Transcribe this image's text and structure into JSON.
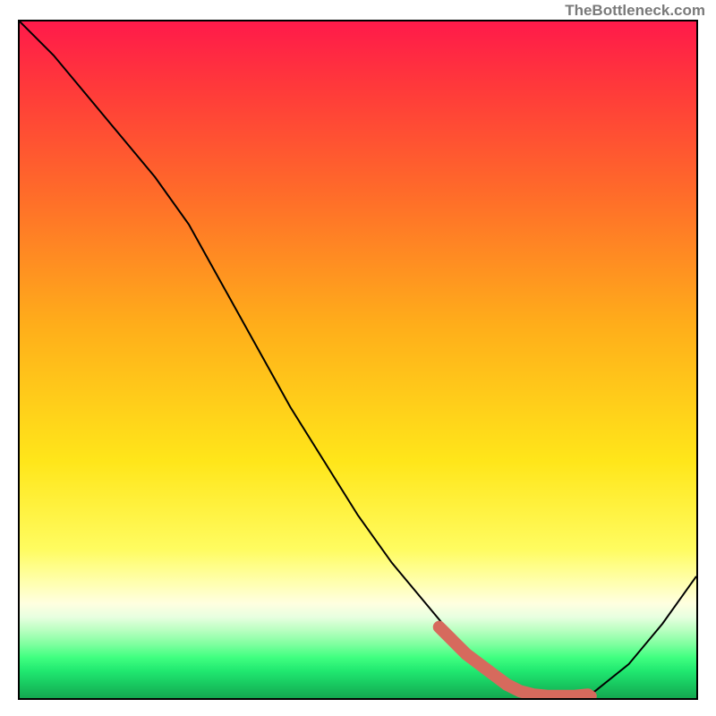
{
  "watermark": "TheBottleneck.com",
  "chart_data": {
    "type": "line",
    "title": "",
    "xlabel": "",
    "ylabel": "",
    "xlim": [
      0,
      100
    ],
    "ylim": [
      0,
      100
    ],
    "grid": false,
    "legend": false,
    "series": [
      {
        "name": "curve",
        "x": [
          0,
          5,
          10,
          15,
          20,
          25,
          30,
          35,
          40,
          45,
          50,
          55,
          60,
          65,
          70,
          75,
          80,
          82,
          85,
          90,
          95,
          100
        ],
        "y": [
          100,
          95,
          89,
          83,
          77,
          70,
          61,
          52,
          43,
          35,
          27,
          20,
          14,
          8,
          4,
          1,
          0,
          0,
          1,
          5,
          11,
          18
        ],
        "color": "#000000"
      },
      {
        "name": "highlight",
        "x": [
          62,
          64,
          66,
          68,
          70,
          72,
          74,
          76,
          78,
          80,
          82,
          84
        ],
        "y": [
          10.5,
          8.5,
          6.5,
          5,
          3.5,
          2,
          1,
          0.5,
          0.3,
          0.3,
          0.3,
          0.5
        ],
        "color": "#d66a5d"
      }
    ],
    "gradient": {
      "top_color": "#ff1a4a",
      "mid_color": "#ffe61a",
      "bottom_color": "#14a850"
    }
  }
}
